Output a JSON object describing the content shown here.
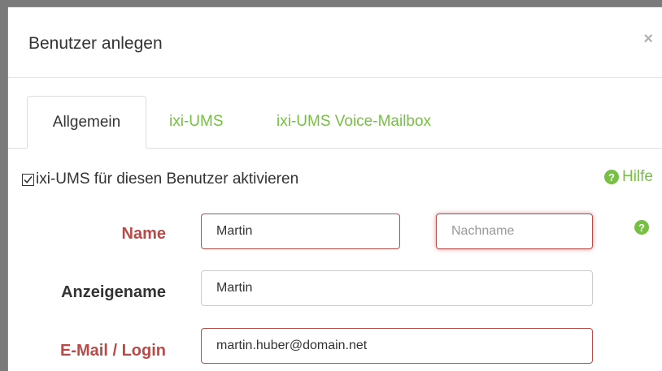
{
  "dialog": {
    "title": "Benutzer anlegen",
    "close_symbol": "×"
  },
  "tabs": [
    {
      "label": "Allgemein",
      "active": true
    },
    {
      "label": "ixi-UMS",
      "active": false
    },
    {
      "label": "ixi-UMS Voice-Mailbox",
      "active": false
    }
  ],
  "form": {
    "activate_label": "ixi-UMS für diesen Benutzer aktivieren",
    "activate_checked": true,
    "help_label": "Hilfe",
    "help_icon": "question-circle-icon",
    "name_label": "Name",
    "first_name_value": "Martin",
    "last_name_placeholder": "Nachname",
    "display_label": "Anzeigename",
    "display_value": "Martin",
    "email_label": "E-Mail / Login",
    "email_value": "martin.huber@domain.net"
  },
  "colors": {
    "accent": "#76c043",
    "error": "#b94a48",
    "text": "#333333"
  }
}
